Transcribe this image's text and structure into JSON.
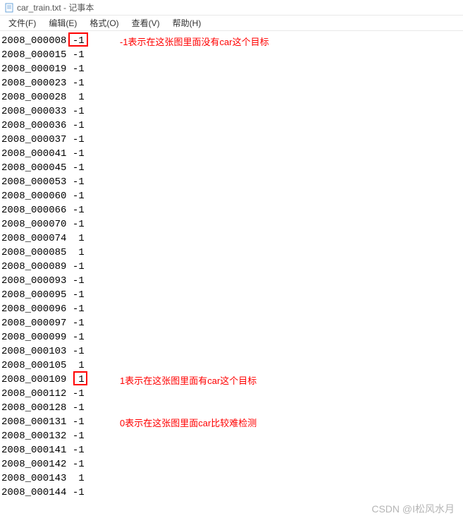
{
  "window": {
    "title": "car_train.txt - 记事本"
  },
  "menu": {
    "file": "文件(F)",
    "edit": "编辑(E)",
    "format": "格式(O)",
    "view": "查看(V)",
    "help": "帮助(H)"
  },
  "lines": [
    "2008_000008 -1",
    "2008_000015 -1",
    "2008_000019 -1",
    "2008_000023 -1",
    "2008_000028  1",
    "2008_000033 -1",
    "2008_000036 -1",
    "2008_000037 -1",
    "2008_000041 -1",
    "2008_000045 -1",
    "2008_000053 -1",
    "2008_000060 -1",
    "2008_000066 -1",
    "2008_000070 -1",
    "2008_000074  1",
    "2008_000085  1",
    "2008_000089 -1",
    "2008_000093 -1",
    "2008_000095 -1",
    "2008_000096 -1",
    "2008_000097 -1",
    "2008_000099 -1",
    "2008_000103 -1",
    "2008_000105  1",
    "2008_000109  1",
    "2008_000112 -1",
    "2008_000128 -1",
    "2008_000131 -1",
    "2008_000132 -1",
    "2008_000141 -1",
    "2008_000142 -1",
    "2008_000143  1",
    "2008_000144 -1"
  ],
  "annotations": {
    "neg1": "-1表示在这张图里面没有car这个目标",
    "pos1": "1表示在这张图里面有car这个目标",
    "zero": "0表示在这张图里面car比较难检测"
  },
  "watermark": "CSDN @I松风水月"
}
